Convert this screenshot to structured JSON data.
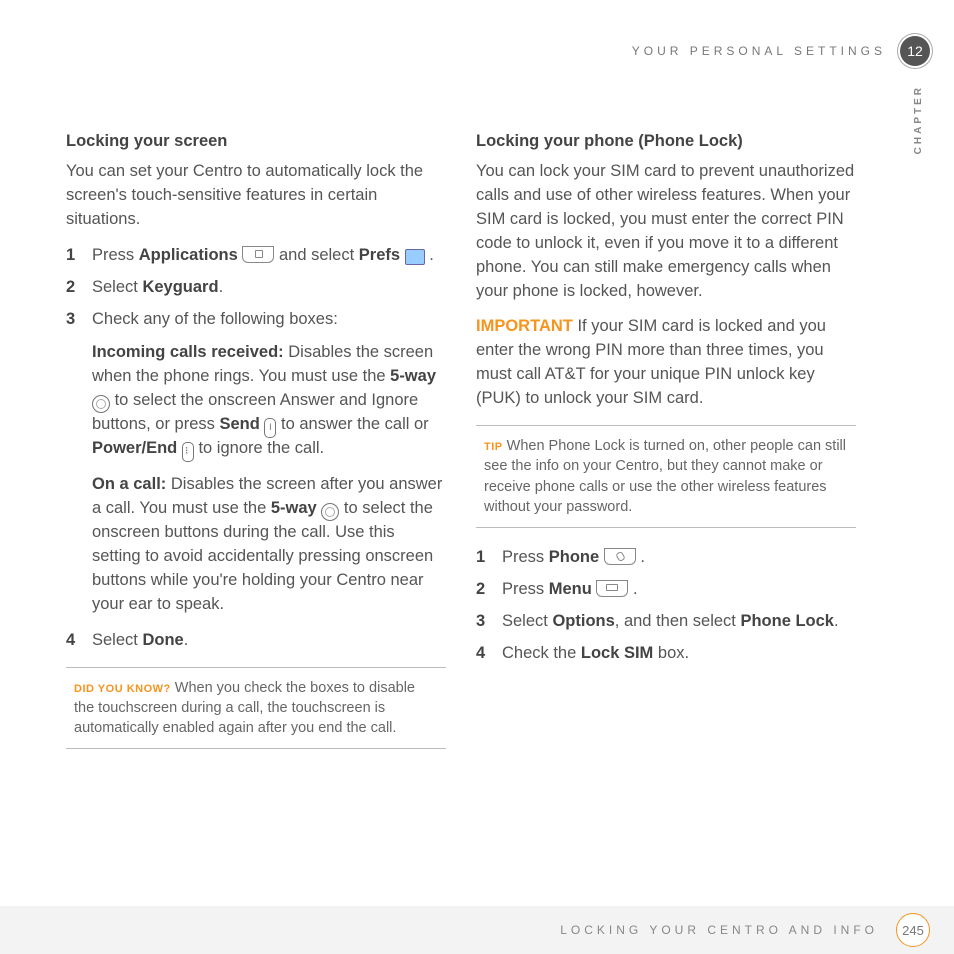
{
  "header": {
    "section": "YOUR PERSONAL SETTINGS",
    "chapterNum": "12",
    "chapterLabel": "CHAPTER"
  },
  "footer": {
    "section": "LOCKING YOUR CENTRO AND INFO",
    "pageNum": "245"
  },
  "left": {
    "title": "Locking your screen",
    "intro": "You can set your Centro to automatically lock the screen's touch-sensitive features in certain situations.",
    "s1a": "Press ",
    "s1b": "Applications",
    "s1c": " and select ",
    "s1d": "Prefs",
    "s1e": " .",
    "s2a": "Select ",
    "s2b": "Keyguard",
    "s2c": ".",
    "s3": "Check any of the following boxes:",
    "p1a": "Incoming calls received:",
    "p1b": " Disables the screen when the phone rings. You must use the ",
    "p1c": "5-way",
    "p1d": " to select the onscreen Answer and Ignore buttons, or press ",
    "p1e": "Send",
    "p1f": " to answer the call or ",
    "p1g": "Power/End",
    "p1h": " to ignore the call.",
    "p2a": "On a call:",
    "p2b": " Disables the screen after you answer a call. You must use the ",
    "p2c": "5-way",
    "p2d": " to select the onscreen buttons during the call. Use this setting to avoid accidentally pressing onscreen buttons while you're holding your Centro near your ear to speak.",
    "s4a": "Select ",
    "s4b": "Done",
    "s4c": ".",
    "boxLabel": "DID YOU KNOW?",
    "boxText": " When you check the boxes to disable the touchscreen during a call, the touchscreen is automatically enabled again after you end the call."
  },
  "right": {
    "title": "Locking your phone (Phone Lock)",
    "intro": "You can lock your SIM card to prevent unauthorized calls and use of other wireless features. When your SIM card is locked, you must enter the correct PIN code to unlock it, even if you move it to a different phone. You can still make emergency calls when your phone is locked, however.",
    "impLabel": "IMPORTANT",
    "impText": " If your SIM card is locked and you enter the wrong PIN more than three times, you must call AT&T for your unique PIN unlock key (PUK) to unlock your SIM card.",
    "tipLabel": "TIP",
    "tipText": " When Phone Lock is turned on, other people can still see the info on your Centro, but they cannot make or receive phone calls or use the other wireless features without your password.",
    "r1a": "Press ",
    "r1b": "Phone",
    "r1c": " .",
    "r2a": "Press ",
    "r2b": "Menu",
    "r2c": " .",
    "r3a": "Select ",
    "r3b": "Options",
    "r3c": ", and then select ",
    "r3d": "Phone Lock",
    "r3e": ".",
    "r4a": "Check the ",
    "r4b": "Lock SIM",
    "r4c": " box."
  }
}
